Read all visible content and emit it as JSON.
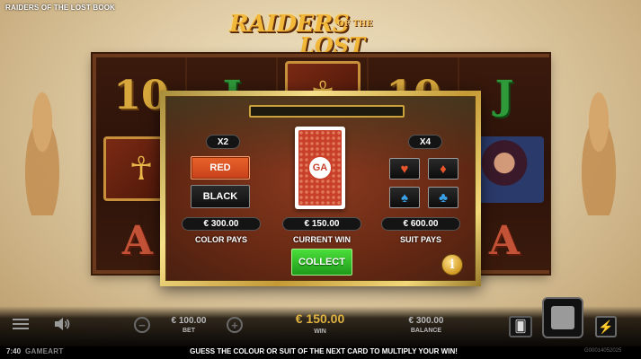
{
  "app": {
    "title": "RAIDERS OF THE LOST BOOK",
    "logo_main": "RAIDERS",
    "logo_of": "OF THE",
    "logo_sub": "LOST BOOK"
  },
  "reels": {
    "symbols": [
      "10",
      "J",
      "10",
      "J",
      "A",
      "A",
      "A"
    ]
  },
  "gamble": {
    "color_multiplier": "X2",
    "suit_multiplier": "X4",
    "red_label": "RED",
    "black_label": "BLACK",
    "card_logo": "GA",
    "suits": {
      "hearts": "♥",
      "diamonds": "♦",
      "spades": "♠",
      "clubs": "♣"
    },
    "color_pays_value": "€ 300.00",
    "color_pays_label": "COLOR PAYS",
    "current_win_value": "€ 150.00",
    "current_win_label": "CURRENT WIN",
    "suit_pays_value": "€ 600.00",
    "suit_pays_label": "SUIT PAYS",
    "collect_label": "COLLECT",
    "info_label": "i"
  },
  "bar": {
    "bet_value": "€ 100.00",
    "bet_label": "BET",
    "win_value": "€ 150.00",
    "win_label": "WIN",
    "balance_value": "€ 300.00",
    "balance_label": "BALANCE",
    "minus": "−",
    "plus": "+",
    "cards_icon": "🂠",
    "turbo_icon": "⚡"
  },
  "footer": {
    "clock": "7:40",
    "brand": "GAMEART",
    "hint": "GUESS THE COLOUR OR SUIT OF THE NEXT CARD TO MULTIPLY YOUR WIN!",
    "build_id": "G00014052025"
  },
  "colors": {
    "red_button": "#d44a20",
    "collect_button": "#2eb82a",
    "gold_frame": "#e8c860",
    "win_amount": "#e0b340"
  }
}
